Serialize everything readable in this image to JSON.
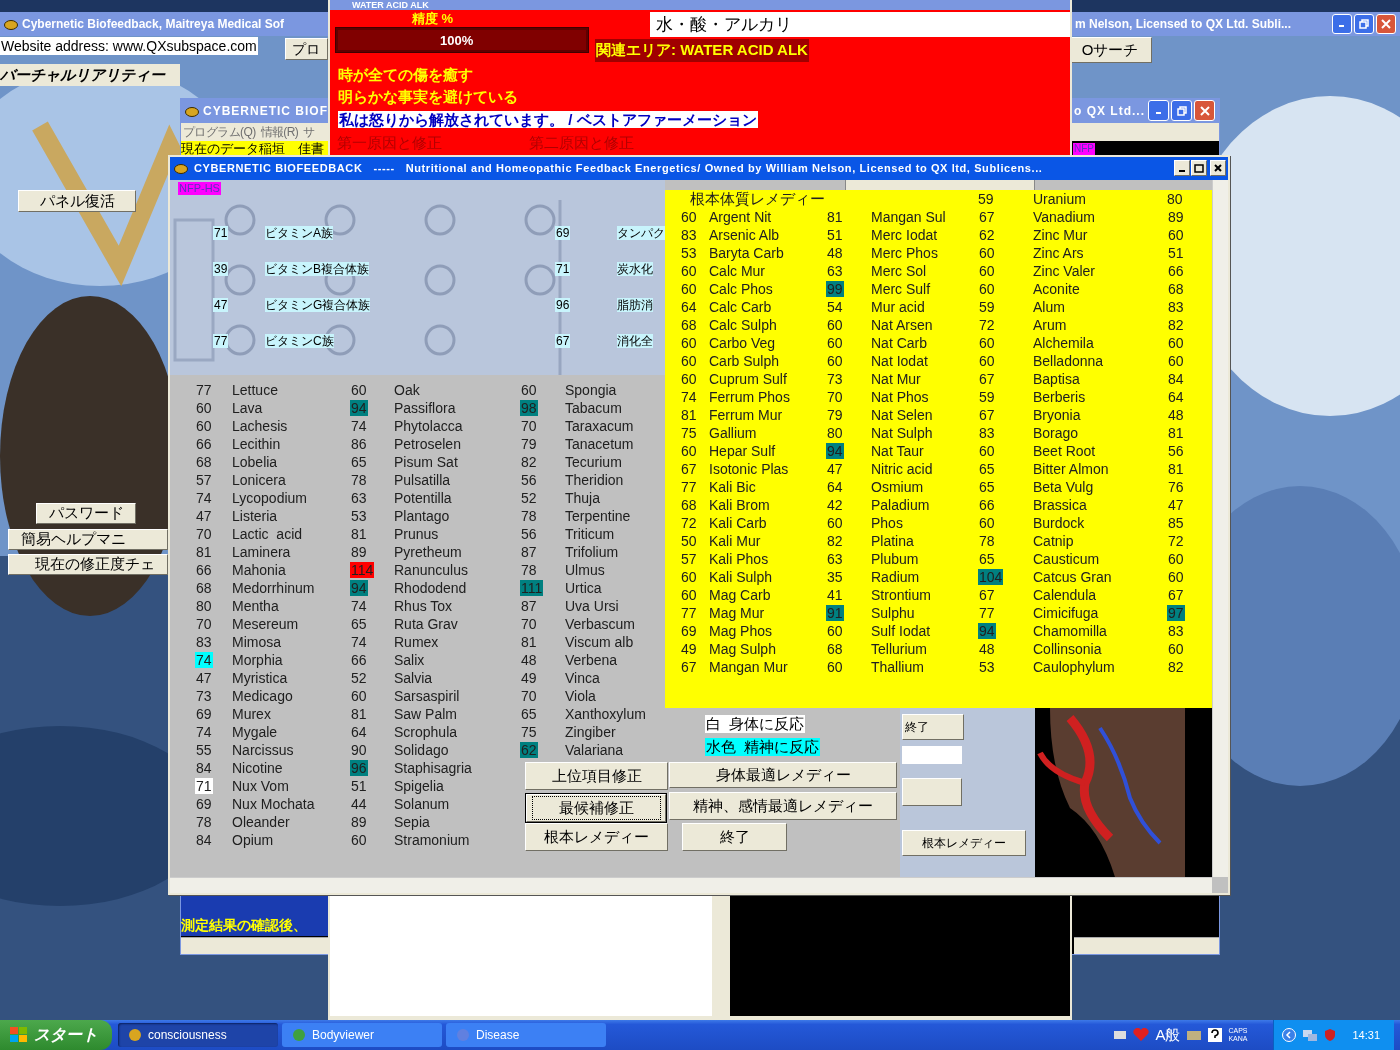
{
  "desktop_window": {
    "title_left": "Cybernetic Biofeedback, Maitreya Medical Sof",
    "title_right": "m Nelson, Licensed to QX Ltd. Subli...",
    "website_field": "Website address: www.QXsubspace.com",
    "program_button": "プロ",
    "search_button": "Oサーチ",
    "vr_label": "バーチャルリアリティー",
    "panel_button": "パネル復活",
    "side_buttons": [
      "パスワード",
      "簡易ヘルプマニ",
      "現在の修正度チェ"
    ]
  },
  "second_window": {
    "title_left": "CYBERNETIC BIOF",
    "title_right": "o QX Ltd...",
    "menu": [
      "プログラム(Q)",
      "情報(R)",
      "サ"
    ],
    "data_strip": "現在のデータ稲垣　佳書",
    "badge": "NFP",
    "footer_text": "測定結果の確認後、"
  },
  "water_window": {
    "title": "WATER ACID ALK",
    "accuracy_label": "精度 %",
    "accuracy": {
      "level": 1,
      "reading": "100%"
    },
    "field": "水・酸・アルカリ",
    "area_label": "関連エリア: WATER ACID ALK",
    "messages": [
      "時が全ての傷を癒す",
      "明らかな事実を避けている"
    ],
    "affirmation": "私は怒りから解放されています。 / ベストアファーメーション",
    "causes": [
      "第一原因と修正",
      "第二原因と修正"
    ]
  },
  "main_window": {
    "title": "CYBERNETIC BIOFEEDBACK   -----   Nutritional and Homeopathic Feedback Energetics/ Owned by William Nelson, Licensed to QX ltd, Sublicens...",
    "badge": "NFP-HS",
    "vitamins": [
      {
        "value": "71",
        "name": "ビタミンA族"
      },
      {
        "value": "39",
        "name": "ビタミンB複合体族"
      },
      {
        "value": "47",
        "name": "ビタミンG複合体族"
      },
      {
        "value": "77",
        "name": "ビタミンC族"
      }
    ],
    "nutrients": [
      {
        "value": "69",
        "name": "タンパク"
      },
      {
        "value": "71",
        "name": "炭水化"
      },
      {
        "value": "96",
        "name": "脂肪消"
      },
      {
        "value": "67",
        "name": "消化全"
      }
    ],
    "remedy_columns": [
      [
        {
          "value": "77",
          "name": "Lettuce"
        },
        {
          "value": "60",
          "name": "Lava"
        },
        {
          "value": "60",
          "name": "Lachesis"
        },
        {
          "value": "66",
          "name": "Lecithin"
        },
        {
          "value": "68",
          "name": "Lobelia"
        },
        {
          "value": "57",
          "name": "Lonicera"
        },
        {
          "value": "74",
          "name": "Lycopodium"
        },
        {
          "value": "47",
          "name": "Listeria"
        },
        {
          "value": "70",
          "name": "Lactic  acid"
        },
        {
          "value": "81",
          "name": "Laminera"
        },
        {
          "value": "66",
          "name": "Mahonia"
        },
        {
          "value": "68",
          "name": "Medorrhinum"
        },
        {
          "value": "80",
          "name": "Mentha"
        },
        {
          "value": "70",
          "name": "Mesereum"
        },
        {
          "value": "83",
          "name": "Mimosa"
        },
        {
          "value": "74",
          "name": "Morphia",
          "color": "#00ffff"
        },
        {
          "value": "47",
          "name": "Myristica"
        },
        {
          "value": "73",
          "name": "Medicago"
        },
        {
          "value": "69",
          "name": "Murex"
        },
        {
          "value": "74",
          "name": "Mygale"
        },
        {
          "value": "55",
          "name": "Narcissus"
        },
        {
          "value": "84",
          "name": "Nicotine"
        },
        {
          "value": "71",
          "name": "Nux Vom",
          "color": "#ffffff"
        },
        {
          "value": "69",
          "name": "Nux Mochata"
        },
        {
          "value": "78",
          "name": "Oleander"
        },
        {
          "value": "84",
          "name": "Opium"
        }
      ],
      [
        {
          "value": "60",
          "name": "Oak"
        },
        {
          "value": "94",
          "name": "Passiflora",
          "color": "#008080"
        },
        {
          "value": "74",
          "name": "Phytolacca"
        },
        {
          "value": "86",
          "name": "Petroselen"
        },
        {
          "value": "65",
          "name": "Pisum Sat"
        },
        {
          "value": "78",
          "name": "Pulsatilla"
        },
        {
          "value": "63",
          "name": "Potentilla"
        },
        {
          "value": "53",
          "name": "Plantago"
        },
        {
          "value": "81",
          "name": "Prunus"
        },
        {
          "value": "89",
          "name": "Pyretheum"
        },
        {
          "value": "114",
          "name": "Ranunculus",
          "color": "#ff0000"
        },
        {
          "value": "94",
          "name": "Rhododend",
          "color": "#008080"
        },
        {
          "value": "74",
          "name": "Rhus Tox"
        },
        {
          "value": "65",
          "name": "Ruta Grav"
        },
        {
          "value": "74",
          "name": "Rumex"
        },
        {
          "value": "66",
          "name": "Salix"
        },
        {
          "value": "52",
          "name": "Salvia"
        },
        {
          "value": "60",
          "name": "Sarsaspiril"
        },
        {
          "value": "81",
          "name": "Saw Palm"
        },
        {
          "value": "64",
          "name": "Scrophula"
        },
        {
          "value": "90",
          "name": "Solidago"
        },
        {
          "value": "96",
          "name": "Staphisagria",
          "color": "#008080"
        },
        {
          "value": "51",
          "name": "Spigelia"
        },
        {
          "value": "44",
          "name": "Solanum"
        },
        {
          "value": "89",
          "name": "Sepia"
        },
        {
          "value": "60",
          "name": "Stramonium"
        }
      ],
      [
        {
          "value": "60",
          "name": "Spongia"
        },
        {
          "value": "98",
          "name": "Tabacum",
          "color": "#008080"
        },
        {
          "value": "70",
          "name": "Taraxacum"
        },
        {
          "value": "79",
          "name": "Tanacetum"
        },
        {
          "value": "82",
          "name": "Tecurium"
        },
        {
          "value": "56",
          "name": "Theridion"
        },
        {
          "value": "52",
          "name": "Thuja"
        },
        {
          "value": "78",
          "name": "Terpentine"
        },
        {
          "value": "56",
          "name": "Triticum"
        },
        {
          "value": "87",
          "name": "Trifolium"
        },
        {
          "value": "78",
          "name": "Ulmus"
        },
        {
          "value": "111",
          "name": "Urtica",
          "color": "#008080"
        },
        {
          "value": "87",
          "name": "Uva Ursi"
        },
        {
          "value": "70",
          "name": "Verbascum"
        },
        {
          "value": "81",
          "name": "Viscum alb"
        },
        {
          "value": "48",
          "name": "Verbena"
        },
        {
          "value": "49",
          "name": "Vinca"
        },
        {
          "value": "70",
          "name": "Viola"
        },
        {
          "value": "65",
          "name": "Xanthoxylum"
        },
        {
          "value": "75",
          "name": "Zingiber"
        },
        {
          "value": "62",
          "name": "Valariana",
          "color": "#008080"
        }
      ]
    ],
    "legend": [
      {
        "text": "白  身体に反応",
        "color": "#ffffff"
      },
      {
        "text": "水色  精神に反応",
        "color": "#00ffff"
      }
    ],
    "buttons": [
      {
        "label": "上位項目修正",
        "focused": false
      },
      {
        "label": "身体最適レメディー",
        "focused": false
      },
      {
        "label": "最候補修正",
        "focused": true
      },
      {
        "label": "精神、感情最適レメディー",
        "focused": false
      },
      {
        "label": "根本レメディー",
        "focused": false
      },
      {
        "label": "終了",
        "focused": false
      }
    ],
    "side_buttons": [
      "終了",
      "根本レメディー"
    ],
    "constitutional": {
      "title": "根本体質レメディー",
      "header": [
        {
          "value": "59",
          "name": "Uranium"
        },
        {
          "value": "80"
        }
      ],
      "rows": [
        [
          {
            "value": "60",
            "name": "Argent Nit"
          },
          {
            "value": "81",
            "name": "Mangan Sul"
          },
          {
            "value": "67",
            "name": "Vanadium"
          },
          {
            "value": "89"
          }
        ],
        [
          {
            "value": "83",
            "name": "Arsenic Alb"
          },
          {
            "value": "51",
            "name": "Merc Iodat"
          },
          {
            "value": "62",
            "name": "Zinc Mur"
          },
          {
            "value": "60"
          }
        ],
        [
          {
            "value": "53",
            "name": "Baryta Carb"
          },
          {
            "value": "48",
            "name": "Merc Phos"
          },
          {
            "value": "60",
            "name": "Zinc Ars"
          },
          {
            "value": "51"
          }
        ],
        [
          {
            "value": "60",
            "name": "Calc Mur"
          },
          {
            "value": "63",
            "name": "Merc Sol"
          },
          {
            "value": "60",
            "name": "Zinc Valer"
          },
          {
            "value": "66"
          }
        ],
        [
          {
            "value": "60",
            "name": "Calc Phos"
          },
          {
            "value": "99",
            "name": "Merc Sulf",
            "color": "#008080"
          },
          {
            "value": "60",
            "name": "Aconite"
          },
          {
            "value": "68"
          }
        ],
        [
          {
            "value": "64",
            "name": "Calc Carb"
          },
          {
            "value": "54",
            "name": "Mur acid"
          },
          {
            "value": "59",
            "name": "Alum"
          },
          {
            "value": "83"
          }
        ],
        [
          {
            "value": "68",
            "name": "Calc Sulph"
          },
          {
            "value": "60",
            "name": "Nat Arsen"
          },
          {
            "value": "72",
            "name": "Arum"
          },
          {
            "value": "82"
          }
        ],
        [
          {
            "value": "60",
            "name": "Carbo Veg"
          },
          {
            "value": "60",
            "name": "Nat Carb"
          },
          {
            "value": "60",
            "name": "Alchemila"
          },
          {
            "value": "60"
          }
        ],
        [
          {
            "value": "60",
            "name": "Carb Sulph"
          },
          {
            "value": "60",
            "name": "Nat Iodat"
          },
          {
            "value": "60",
            "name": "Belladonna"
          },
          {
            "value": "60"
          }
        ],
        [
          {
            "value": "60",
            "name": "Cuprum Sulf"
          },
          {
            "value": "73",
            "name": "Nat Mur"
          },
          {
            "value": "67",
            "name": "Baptisa"
          },
          {
            "value": "84"
          }
        ],
        [
          {
            "value": "74",
            "name": "Ferrum Phos"
          },
          {
            "value": "70",
            "name": "Nat Phos"
          },
          {
            "value": "59",
            "name": "Berberis"
          },
          {
            "value": "64"
          }
        ],
        [
          {
            "value": "81",
            "name": "Ferrum Mur"
          },
          {
            "value": "79",
            "name": "Nat Selen"
          },
          {
            "value": "67",
            "name": "Bryonia"
          },
          {
            "value": "48"
          }
        ],
        [
          {
            "value": "75",
            "name": "Gallium"
          },
          {
            "value": "80",
            "name": "Nat Sulph"
          },
          {
            "value": "83",
            "name": "Borago"
          },
          {
            "value": "81"
          }
        ],
        [
          {
            "value": "60",
            "name": "Hepar Sulf"
          },
          {
            "value": "94",
            "name": "Nat Taur",
            "color": "#008080"
          },
          {
            "value": "60",
            "name": "Beet Root"
          },
          {
            "value": "56"
          }
        ],
        [
          {
            "value": "67",
            "name": "Isotonic Plas"
          },
          {
            "value": "47",
            "name": "Nitric acid"
          },
          {
            "value": "65",
            "name": "Bitter Almon"
          },
          {
            "value": "81"
          }
        ],
        [
          {
            "value": "77",
            "name": "Kali Bic"
          },
          {
            "value": "64",
            "name": "Osmium"
          },
          {
            "value": "65",
            "name": "Beta Vulg"
          },
          {
            "value": "76"
          }
        ],
        [
          {
            "value": "68",
            "name": "Kali Brom"
          },
          {
            "value": "42",
            "name": "Paladium"
          },
          {
            "value": "66",
            "name": "Brassica"
          },
          {
            "value": "47"
          }
        ],
        [
          {
            "value": "72",
            "name": "Kali Carb"
          },
          {
            "value": "60",
            "name": "Phos"
          },
          {
            "value": "60",
            "name": "Burdock"
          },
          {
            "value": "85"
          }
        ],
        [
          {
            "value": "50",
            "name": "Kali Mur"
          },
          {
            "value": "82",
            "name": "Platina"
          },
          {
            "value": "78",
            "name": "Catnip"
          },
          {
            "value": "72"
          }
        ],
        [
          {
            "value": "57",
            "name": "Kali Phos"
          },
          {
            "value": "63",
            "name": "Plubum"
          },
          {
            "value": "65",
            "name": "Causticum"
          },
          {
            "value": "60"
          }
        ],
        [
          {
            "value": "60",
            "name": "Kali Sulph"
          },
          {
            "value": "35",
            "name": "Radium"
          },
          {
            "value": "104",
            "name": "Catcus Gran",
            "color": "#008080"
          },
          {
            "value": "60"
          }
        ],
        [
          {
            "value": "60",
            "name": "Mag Carb"
          },
          {
            "value": "41",
            "name": "Strontium"
          },
          {
            "value": "67",
            "name": "Calendula"
          },
          {
            "value": "67"
          }
        ],
        [
          {
            "value": "77",
            "name": "Mag Mur"
          },
          {
            "value": "91",
            "name": "Sulphu",
            "color": "#008080"
          },
          {
            "value": "77",
            "name": "Cimicifuga"
          },
          {
            "value": "97",
            "color": "#008080"
          }
        ],
        [
          {
            "value": "69",
            "name": "Mag Phos"
          },
          {
            "value": "60",
            "name": "Sulf Iodat"
          },
          {
            "value": "94",
            "name": "Chamomilla",
            "color": "#008080"
          },
          {
            "value": "83"
          }
        ],
        [
          {
            "value": "49",
            "name": "Mag Sulph"
          },
          {
            "value": "68",
            "name": "Tellurium"
          },
          {
            "value": "48",
            "name": "Collinsonia"
          },
          {
            "value": "60"
          }
        ],
        [
          {
            "value": "67",
            "name": "Mangan Mur"
          },
          {
            "value": "60",
            "name": "Thallium"
          },
          {
            "value": "53",
            "name": "Caulophylum"
          },
          {
            "value": "82"
          }
        ]
      ]
    }
  },
  "taskbar": {
    "start": "スタート",
    "tasks": [
      {
        "label": "consciousness",
        "selected": true
      },
      {
        "label": "Bodyviewer",
        "selected": false
      },
      {
        "label": "Disease",
        "selected": false
      }
    ],
    "ime": "A般",
    "caps": "CAPS",
    "kana": "KANA",
    "clock": "14:31"
  }
}
